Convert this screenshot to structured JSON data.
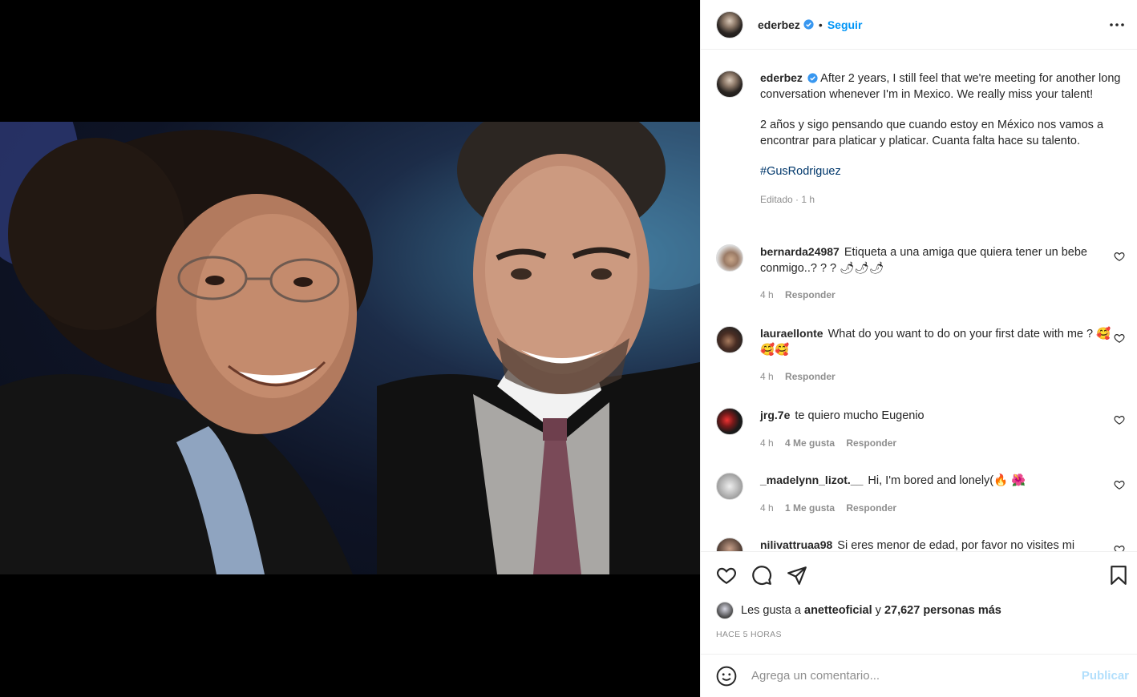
{
  "post": {
    "username": "ederbez",
    "follow_label": "Seguir",
    "separator": "•",
    "more_icon": "more-horizontal-icon",
    "caption_p1": "After 2 years, I still feel that we're meeting for another long conversation whenever I'm in Mexico. We really miss your talent!",
    "caption_p2": "2 años y sigo pensando que cuando estoy en México nos vamos a encontrar para platicar y platicar. Cuanta falta hace su talento.",
    "hashtag": "#GusRodriguez",
    "edited": "Editado · 1 h"
  },
  "comments": [
    {
      "user": "bernarda24987",
      "text": "Etiqueta a una amiga que quiera tener un bebe conmigo..? ? ? 🌶🌶🌶",
      "time": "4 h",
      "likes": "",
      "reply": "Responder"
    },
    {
      "user": "lauraellonte",
      "text": "What do you want to do on your first date with me ? 🥰🥰🥰",
      "time": "4 h",
      "likes": "",
      "reply": "Responder"
    },
    {
      "user": "jrg.7e",
      "text": "te quiero mucho Eugenio",
      "time": "4 h",
      "likes": "4 Me gusta",
      "reply": "Responder"
    },
    {
      "user": "_madelynn_lizot.__",
      "text": "Hi, I'm bored and lonely(🔥 🌺",
      "time": "4 h",
      "likes": "1 Me gusta",
      "reply": "Responder"
    },
    {
      "user": "nilivattruaa98",
      "text": "Si eres menor de edad, por favor no visites mi",
      "time": "",
      "likes": "",
      "reply": ""
    }
  ],
  "actions": {
    "likes_prefix": "Les gusta a",
    "liked_by": "anetteoficial",
    "likes_middle": "y",
    "likes_count": "27,627 personas más",
    "timestamp": "HACE 5 HORAS"
  },
  "add_comment": {
    "placeholder": "Agrega un comentario...",
    "publish_label": "Publicar"
  },
  "colors": {
    "accent": "#0095f6",
    "publish_disabled": "#b2dffc",
    "hashtag": "#00376b",
    "muted": "#8e8e8e"
  }
}
